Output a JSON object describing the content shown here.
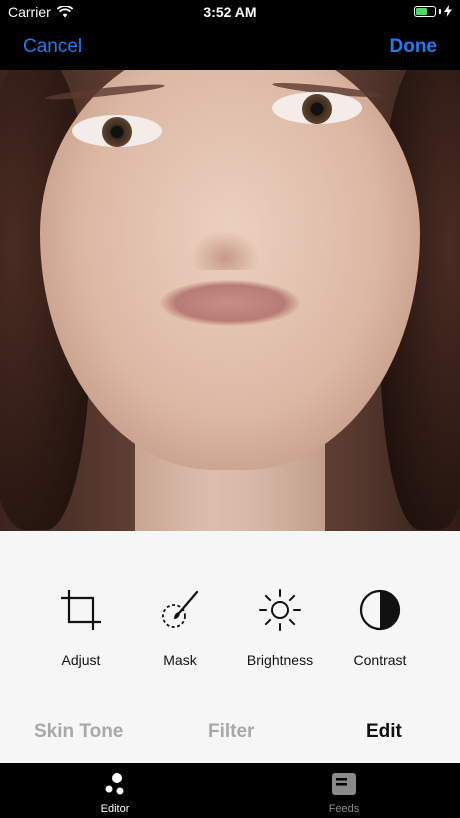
{
  "status_bar": {
    "carrier": "Carrier",
    "time": "3:52 AM",
    "icons": [
      "wifi-icon",
      "battery-icon",
      "charging-bolt-icon"
    ]
  },
  "nav_bar": {
    "cancel_label": "Cancel",
    "done_label": "Done"
  },
  "photo": {
    "icon": "portrait-photo"
  },
  "tools": [
    {
      "label": "Adjust",
      "icon": "crop-icon"
    },
    {
      "label": "Mask",
      "icon": "brush-mask-icon"
    },
    {
      "label": "Brightness",
      "icon": "sun-icon"
    },
    {
      "label": "Contrast",
      "icon": "contrast-icon"
    }
  ],
  "tabs": [
    {
      "label": "Skin Tone",
      "active": false
    },
    {
      "label": "Filter",
      "active": false
    },
    {
      "label": "Edit",
      "active": true
    }
  ],
  "tab_bar": [
    {
      "label": "Editor",
      "icon": "editor-dots-icon",
      "active": true
    },
    {
      "label": "Feeds",
      "icon": "feeds-card-icon",
      "active": false
    }
  ],
  "colors": {
    "accent": "#1e7cf2",
    "battery": "#4cd964",
    "panel": "#f6f6f6",
    "inactive_tab": "#a8a8a8"
  }
}
